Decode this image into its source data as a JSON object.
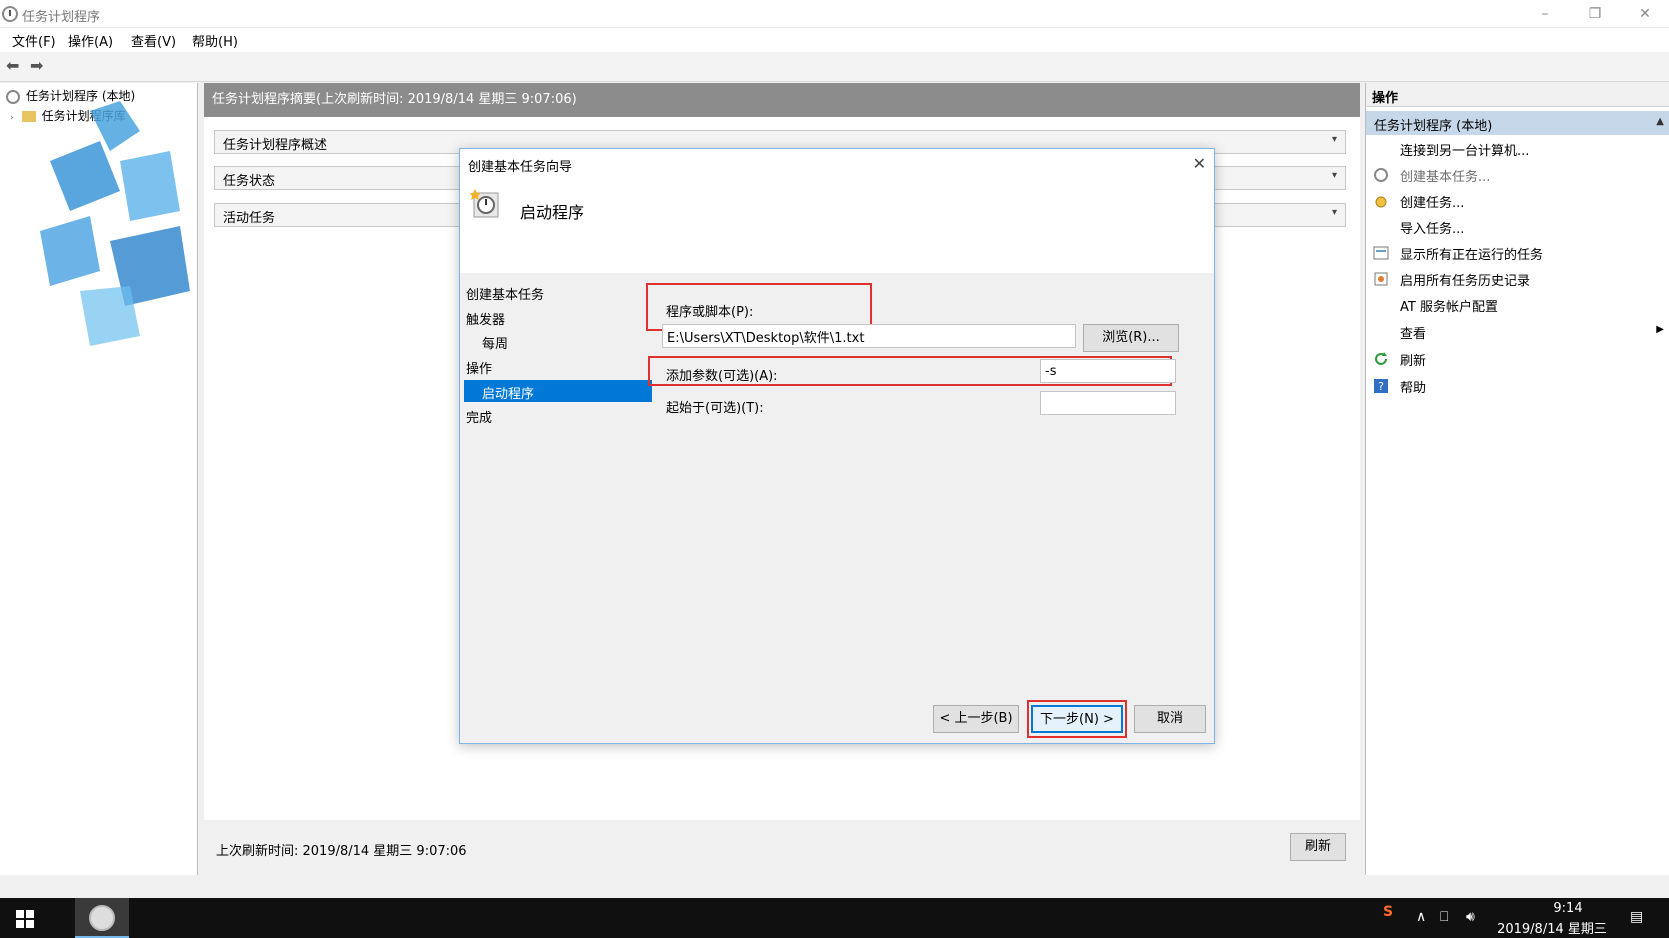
{
  "window": {
    "title": "任务计划程序",
    "minimize": "–",
    "restore": "❐",
    "close": "✕"
  },
  "menu": [
    "文件(F)",
    "操作(A)",
    "查看(V)",
    "帮助(H)"
  ],
  "tree": {
    "root": "任务计划程序 (本地)",
    "child": "任务计划程序库"
  },
  "center": {
    "header": "任务计划程序摘要(上次刷新时间: 2019/8/14 星期三 9:07:06)",
    "sections": [
      "任务计划程序概述",
      "任务状态",
      "活动任务"
    ],
    "footer_label": "上次刷新时间: 2019/8/14 星期三 9:07:06",
    "refresh_button": "刷新"
  },
  "actions": {
    "header": "操作",
    "section": "任务计划程序 (本地)",
    "items": [
      "连接到另一台计算机...",
      "创建基本任务...",
      "创建任务...",
      "导入任务...",
      "显示所有正在运行的任务",
      "启用所有任务历史记录",
      "AT 服务帐户配置",
      "查看",
      "刷新",
      "帮助"
    ]
  },
  "dialog": {
    "title": "创建基本任务向导",
    "header_title": "启动程序",
    "steps": [
      "创建基本任务",
      "触发器",
      "每周",
      "操作",
      "启动程序",
      "完成"
    ],
    "program_label": "程序或脚本(P):",
    "program_value": "E:\\Users\\XT\\Desktop\\软件\\1.txt",
    "browse_button": "浏览(R)...",
    "args_label": "添加参数(可选)(A):",
    "args_value": "-s",
    "start_label": "起始于(可选)(T):",
    "start_value": "",
    "back_button": "< 上一步(B)",
    "next_button": "下一步(N) >",
    "cancel_button": "取消"
  },
  "taskbar": {
    "time": "9:14",
    "date": "2019/8/14 星期三"
  },
  "colors": {
    "accent": "#0078d7",
    "highlight": "#e03030",
    "selected_section": "#c7d7ea"
  }
}
